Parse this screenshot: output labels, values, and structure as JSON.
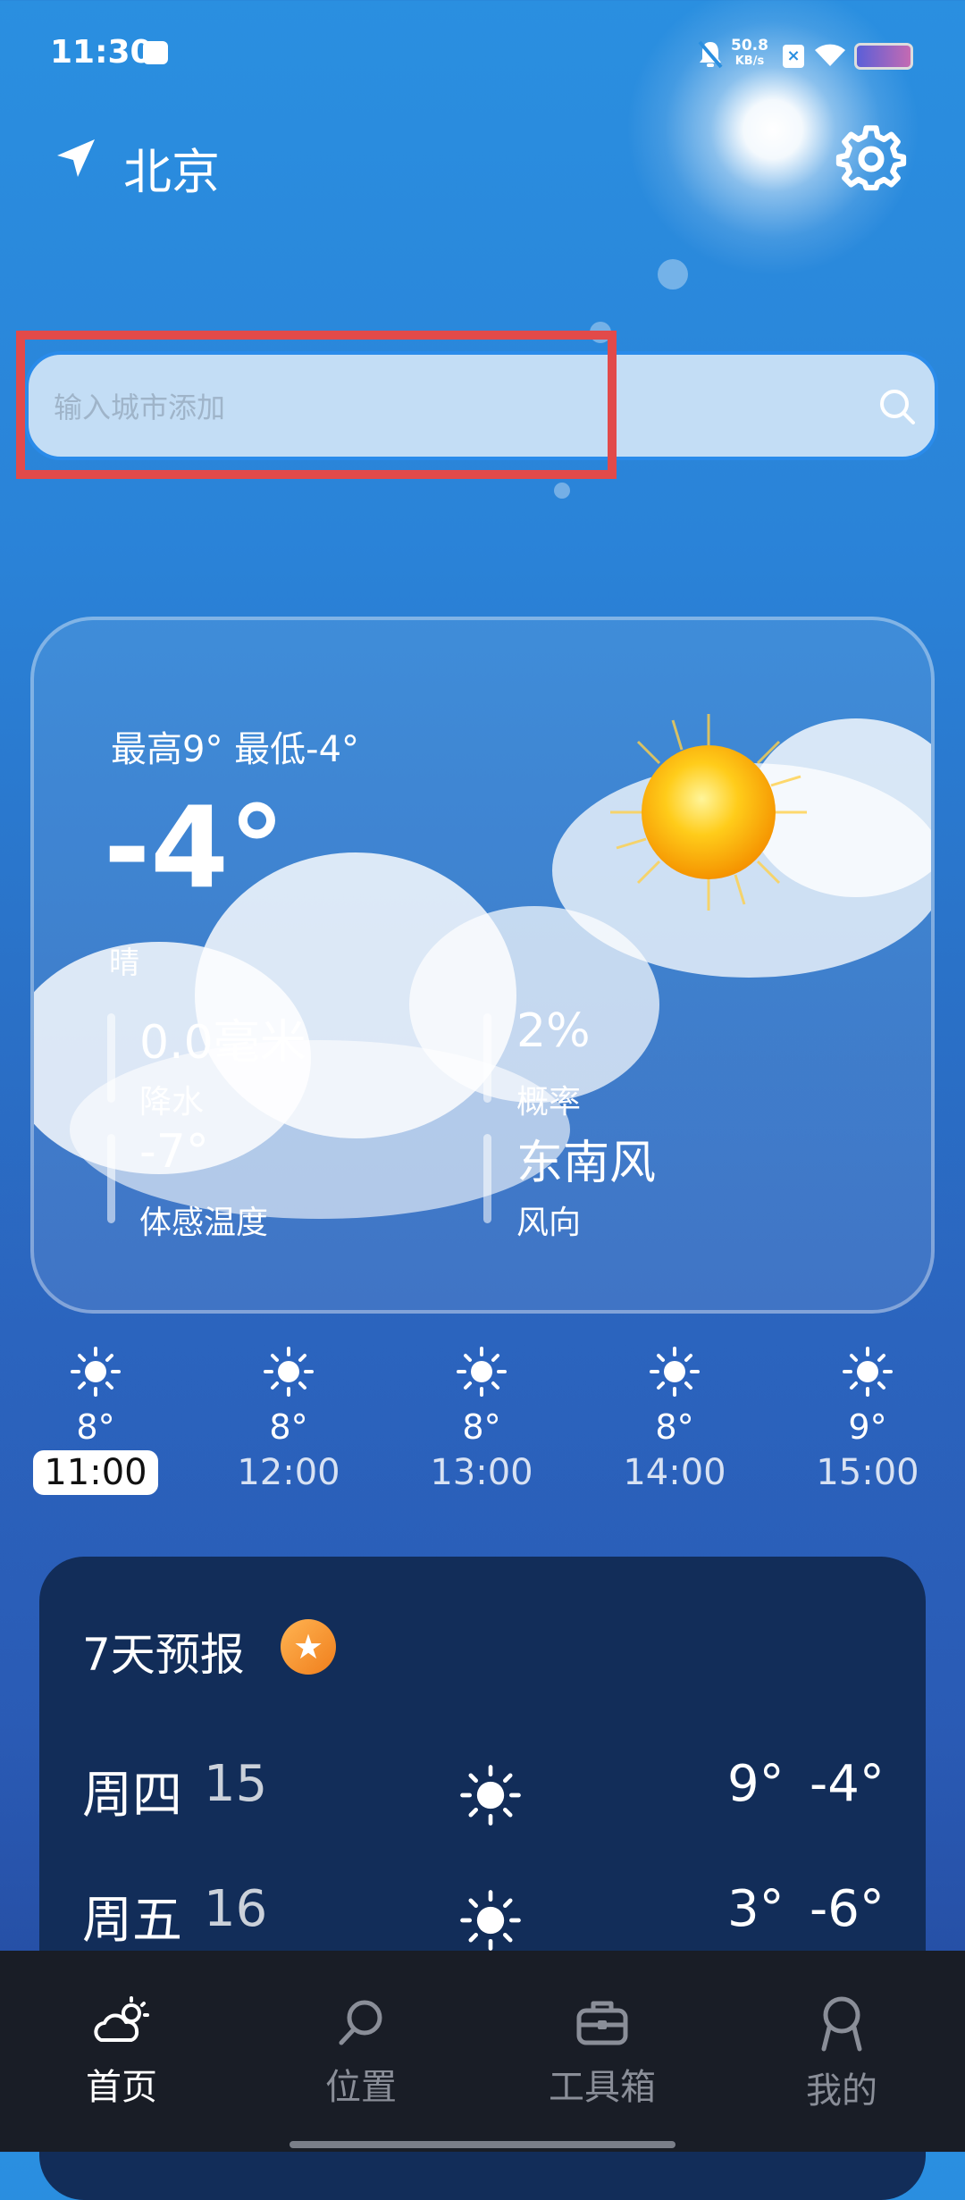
{
  "status_bar": {
    "time": "11:30",
    "net_speed_value": "50.8",
    "net_speed_unit": "KB/s"
  },
  "header": {
    "city": "北京",
    "location_icon": "location-arrow-icon",
    "settings_icon": "gear-icon"
  },
  "search": {
    "placeholder": "输入城市添加",
    "icon": "search-icon"
  },
  "current": {
    "high_low": "最高9° 最低-4°",
    "temperature": "-4°",
    "condition": "晴",
    "stats": [
      {
        "value": "0.0毫米",
        "label": "降水"
      },
      {
        "value": "2%",
        "label": "概率"
      },
      {
        "value": "-7°",
        "label": "体感温度"
      },
      {
        "value": "东南风",
        "label": "风向"
      }
    ]
  },
  "hourly": [
    {
      "temp": "8°",
      "time": "11:00",
      "active": true
    },
    {
      "temp": "8°",
      "time": "12:00"
    },
    {
      "temp": "8°",
      "time": "13:00"
    },
    {
      "temp": "8°",
      "time": "14:00"
    },
    {
      "temp": "9°",
      "time": "15:00"
    }
  ],
  "forecast": {
    "title": "7天预报",
    "days": [
      {
        "day": "周四",
        "date": "15",
        "high": "9°",
        "low": "-4°"
      },
      {
        "day": "周五",
        "date": "16",
        "high": "3°",
        "low": "-6°"
      }
    ]
  },
  "nav": [
    {
      "label": "首页",
      "icon": "cloud-sun-icon",
      "active": true
    },
    {
      "label": "位置",
      "icon": "search-icon"
    },
    {
      "label": "工具箱",
      "icon": "toolbox-icon"
    },
    {
      "label": "我的",
      "icon": "user-icon"
    }
  ],
  "colors": {
    "highlight": "#e24a4a",
    "forecast_bg": "#122d59",
    "nav_bg": "#191d26"
  }
}
